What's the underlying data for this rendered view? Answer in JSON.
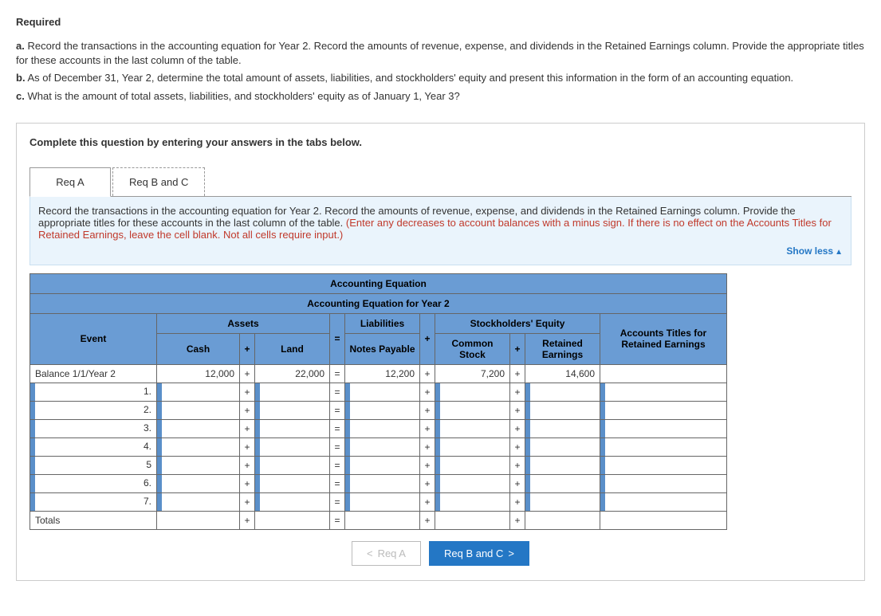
{
  "heading": "Required",
  "items": {
    "a_b": "a.",
    "a": "Record the transactions in the accounting equation for Year 2. Record the amounts of revenue, expense, and dividends in the Retained Earnings column. Provide the appropriate titles for these accounts in the last column of the table.",
    "b_b": "b.",
    "b": "As of December 31, Year 2, determine the total amount of assets, liabilities, and stockholders' equity and present this information in the form of an accounting equation.",
    "c_b": "c.",
    "c": "What is the amount of total assets, liabilities, and stockholders' equity as of January 1, Year 3?"
  },
  "complete_line": "Complete this question by entering your answers in the tabs below.",
  "tabs": {
    "a": "Req A",
    "bc": "Req B and C"
  },
  "instr": {
    "main": "Record the transactions in the accounting equation for Year 2. Record the amounts of revenue, expense, and dividends in the Retained Earnings column. Provide the appropriate titles for these accounts in the last column of the table. ",
    "red": "(Enter any decreases to account balances with a minus sign. If there is no effect on the Accounts Titles for Retained Earnings, leave the cell blank. Not all cells require input.)"
  },
  "show_less": "Show less",
  "table": {
    "title1": "Accounting Equation",
    "title2": "Accounting Equation for Year 2",
    "h_event": "Event",
    "h_assets": "Assets",
    "h_liab": "Liabilities",
    "h_se": "Stockholders' Equity",
    "h_titles": "Accounts Titles for Retained Earnings",
    "h_cash": "Cash",
    "h_land": "Land",
    "h_notes": "Notes Payable",
    "h_common": "Common Stock",
    "h_ret": "Retained Earnings",
    "op_eq": "=",
    "op_pl": "+",
    "balance_label": "Balance 1/1/Year 2",
    "balance": {
      "cash": "12,000",
      "land": "22,000",
      "notes": "12,200",
      "common": "7,200",
      "ret": "14,600"
    },
    "rows": [
      "1.",
      "2.",
      "3.",
      "4.",
      "5",
      "6.",
      "7."
    ],
    "totals_label": "Totals"
  },
  "nav": {
    "prev": "Req A",
    "next": "Req B and C"
  }
}
